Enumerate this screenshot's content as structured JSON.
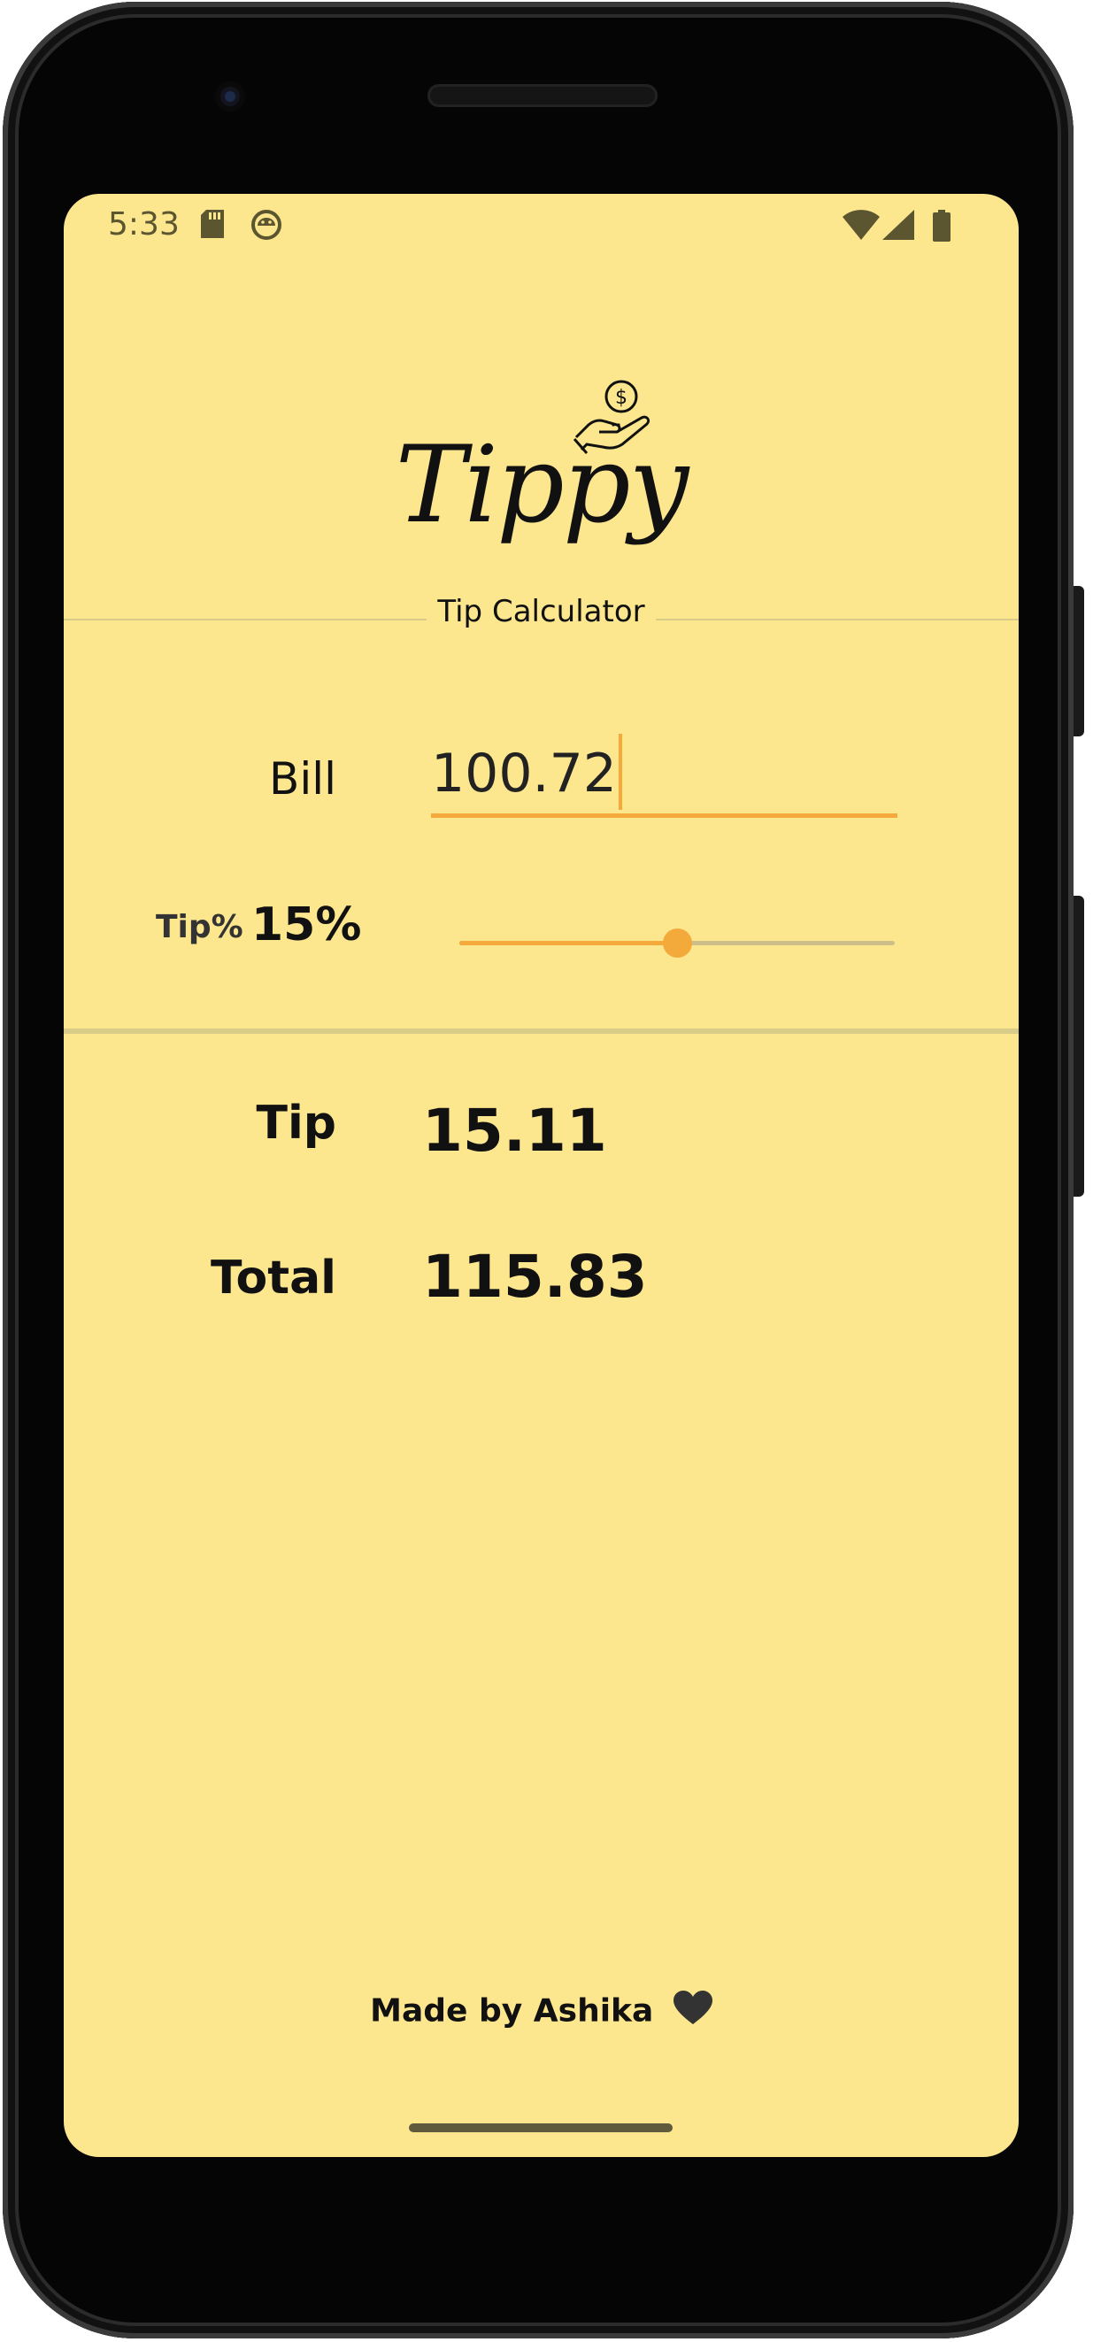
{
  "status_bar": {
    "time": "5:33"
  },
  "header": {
    "brand": "Tippy",
    "subtitle": "Tip Calculator"
  },
  "bill": {
    "label": "Bill",
    "value": "100.72"
  },
  "tip_percent": {
    "label": "Tip%",
    "value_text": "15%",
    "slider_value": 15,
    "slider_max": 30
  },
  "results": {
    "tip_label": "Tip",
    "tip_value": "15.11",
    "total_label": "Total",
    "total_value": "115.83"
  },
  "footer": {
    "text": "Made by Ashika"
  },
  "colors": {
    "background": "#fce68e",
    "accent": "#f4a93b"
  },
  "icons": {
    "logo": "hand-holding-coin-icon",
    "status": [
      "sd-card-icon",
      "android-debug-icon",
      "wifi-icon",
      "signal-icon",
      "battery-icon"
    ],
    "footer": "black-heart-icon"
  }
}
